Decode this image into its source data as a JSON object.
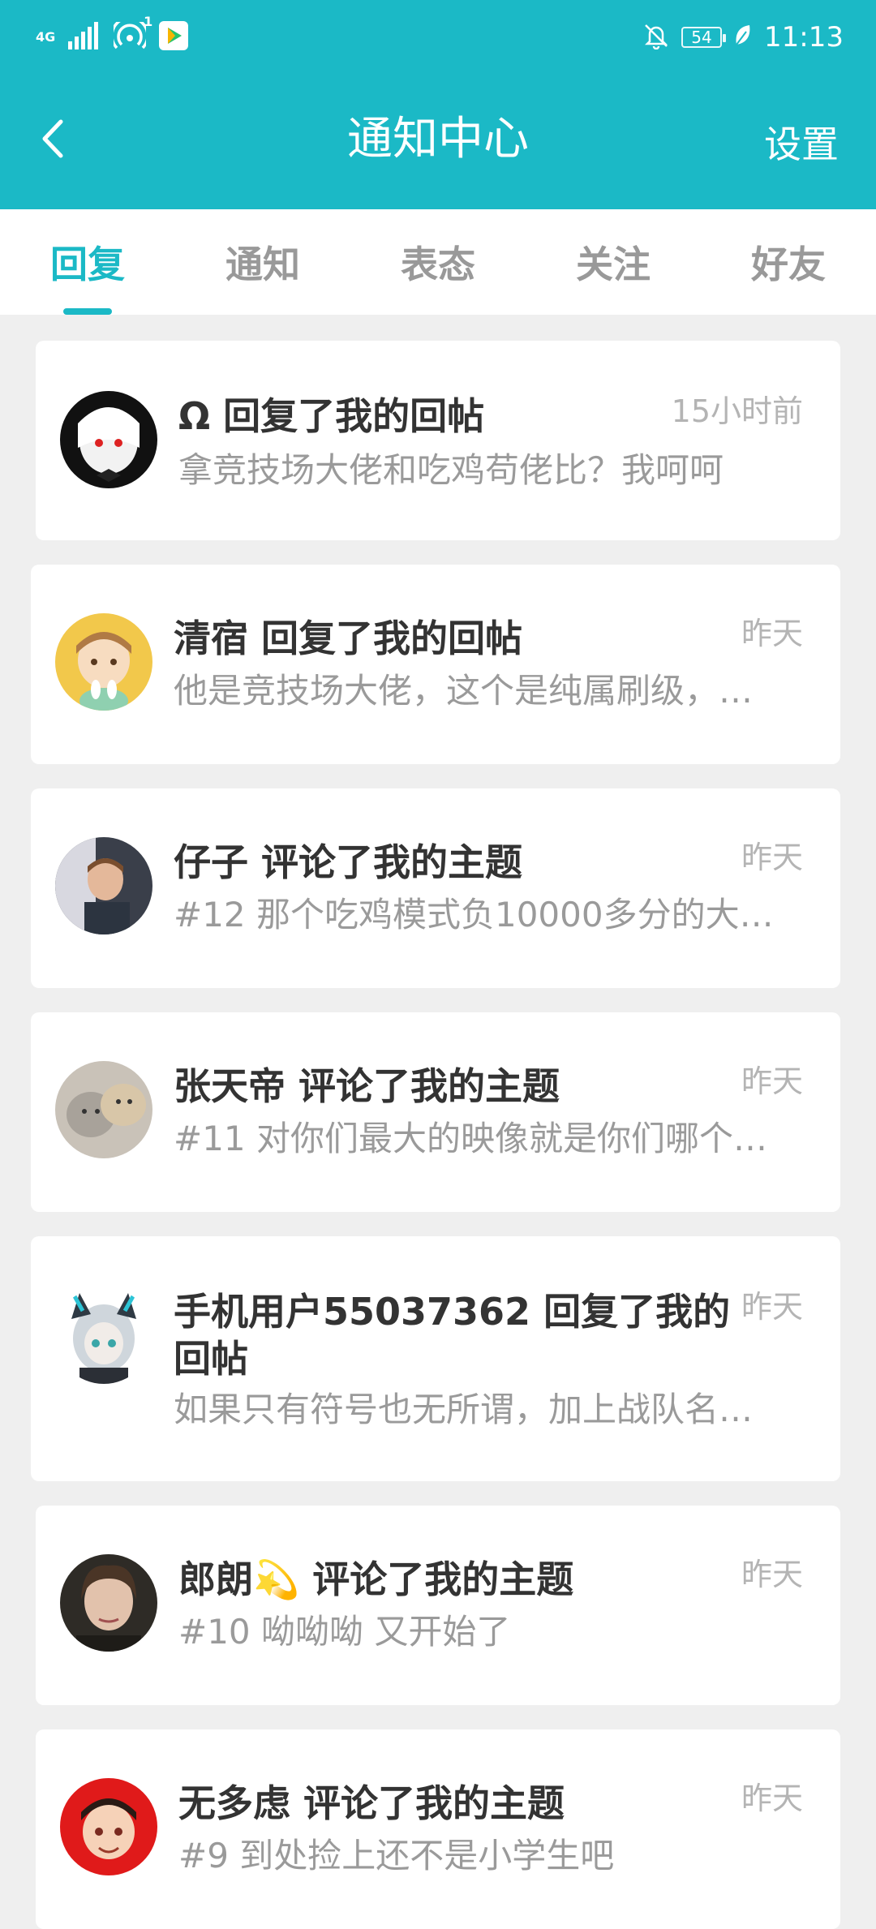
{
  "status_bar": {
    "signal_text": "4G",
    "wifi_badge": "1",
    "battery": "54",
    "time": "11:13"
  },
  "header": {
    "title": "通知中心",
    "settings_label": "设置"
  },
  "tabs": [
    {
      "label": "回复",
      "active": true
    },
    {
      "label": "通知",
      "active": false
    },
    {
      "label": "表态",
      "active": false
    },
    {
      "label": "关注",
      "active": false
    },
    {
      "label": "好友",
      "active": false
    }
  ],
  "notifications": [
    {
      "title": "Ω 回复了我的回帖",
      "time": "15小时前",
      "snippet": "拿竞技场大佬和吃鸡苟佬比？我呵呵"
    },
    {
      "title": "清宿 回复了我的回帖",
      "time": "昨天",
      "snippet": "他是竞技场大佬，这个是纯属刷级，…"
    },
    {
      "title": "仔子 评论了我的主题",
      "time": "昨天",
      "snippet": "#12 那个吃鸡模式负10000多分的大…"
    },
    {
      "title": "张天帝 评论了我的主题",
      "time": "昨天",
      "snippet": "#11 对你们最大的映像就是你们哪个…"
    },
    {
      "title_line1": "手机用户55037362 回复了我的",
      "title_line2": "回帖",
      "time": "昨天",
      "snippet": "如果只有符号也无所谓，加上战队名…"
    },
    {
      "title": "郎朗💫 评论了我的主题",
      "time": "昨天",
      "snippet": "#10 呦呦呦 又开始了"
    },
    {
      "title": "无多虑 评论了我的主题",
      "time": "昨天",
      "snippet": "#9 到处捡上还不是小学生吧"
    }
  ],
  "colors": {
    "accent": "#1bb9c6",
    "page_bg": "#efefef",
    "card_bg": "#ffffff"
  }
}
